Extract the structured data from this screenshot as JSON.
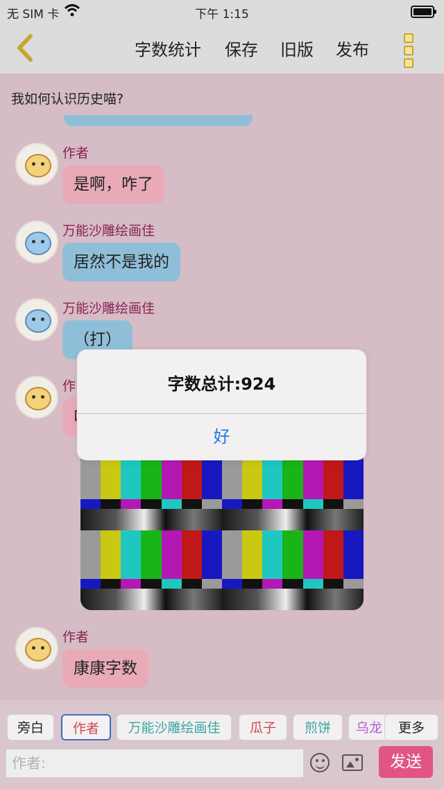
{
  "status_bar": {
    "carrier": "无 SIM 卡",
    "time": "下午 1:15"
  },
  "nav": {
    "word_count_label": "字数统计",
    "save_label": "保存",
    "old_version_label": "旧版",
    "publish_label": "发布"
  },
  "title": "我如何认识历史喵?",
  "messages": [
    {
      "name": "作者",
      "text": "是啊，咋了",
      "color": "#e8aab7"
    },
    {
      "name": "万能沙雕绘画佳",
      "text": "居然不是我的",
      "color": "#8fbfd8"
    },
    {
      "name": "万能沙雕绘画佳",
      "text": "（打）",
      "color": "#8fbfd8"
    },
    {
      "name": "作",
      "text": "叫"
    },
    {
      "name": "作者",
      "text": "康康字数",
      "color": "#e8aab7"
    }
  ],
  "dialog": {
    "message": "字数总计:924",
    "ok_label": "好"
  },
  "toolbar": {
    "chips": [
      {
        "label": "旁白",
        "color": "#222222"
      },
      {
        "label": "作者",
        "color": "#d0484f"
      },
      {
        "label": "万能沙雕绘画佳",
        "color": "#3aa6a0"
      },
      {
        "label": "瓜子",
        "color": "#d0484f"
      },
      {
        "label": "煎饼",
        "color": "#3aa6a0"
      },
      {
        "label": "乌龙",
        "color": "#b45ad0"
      }
    ],
    "more_label": "更多",
    "input_placeholder": "作者:",
    "send_label": "发送"
  },
  "colors": {
    "accent_blue": "#1f7ae0",
    "send_pink": "#e15584",
    "background": "#d5bcc5"
  }
}
